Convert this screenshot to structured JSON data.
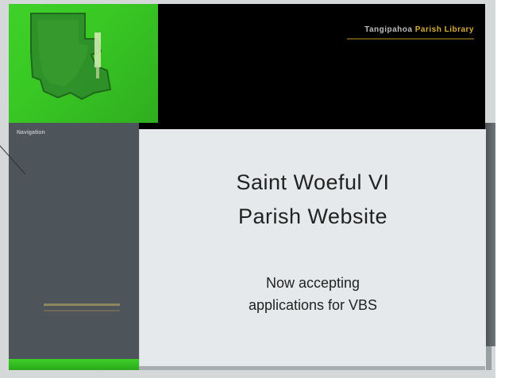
{
  "header": {
    "title_prefix": "Tangipahoa",
    "title_accent": "Parish Library"
  },
  "sidebar": {
    "heading": "Navigation"
  },
  "main": {
    "headline_line1": "Saint Woeful VI",
    "headline_line2": "Parish Website",
    "subline_line1": "Now accepting",
    "subline_line2": "applications for VBS"
  },
  "colors": {
    "logo_green": "#3fd12a",
    "accent_gold": "#d4ad3a",
    "sidebar_gray": "#4e555a",
    "card_bg": "#e6e9eb"
  }
}
